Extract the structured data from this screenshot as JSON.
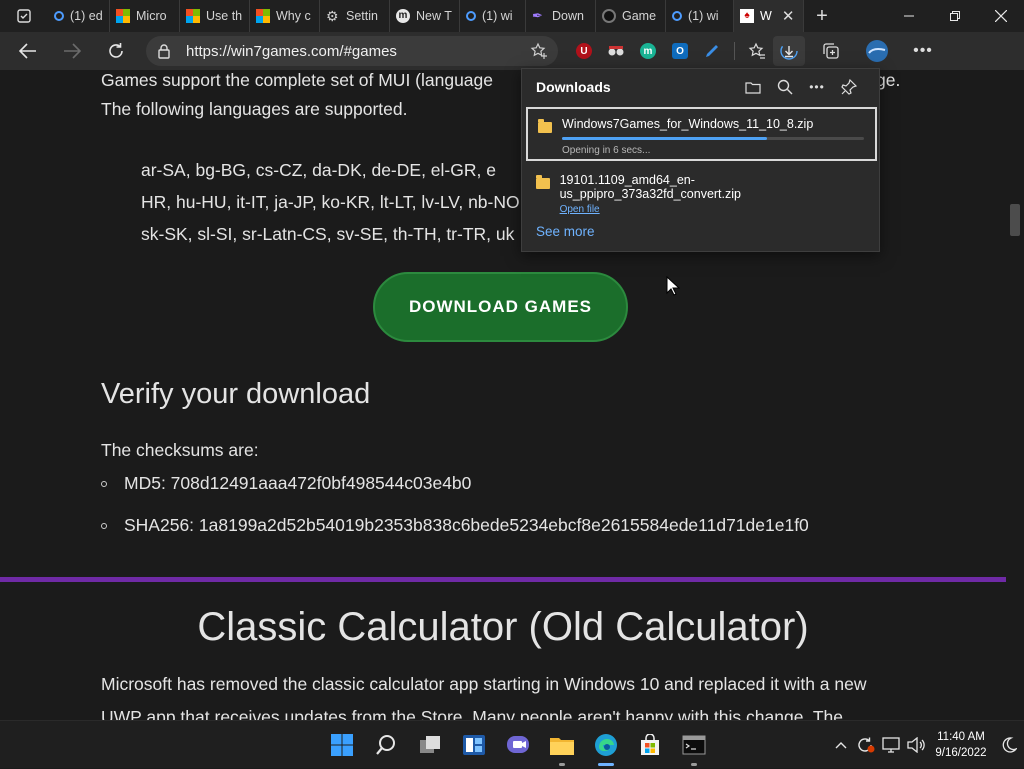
{
  "tabs": [
    {
      "icon": "search-favicon",
      "label": "(1) ed"
    },
    {
      "icon": "microsoft-favicon",
      "label": "Micro"
    },
    {
      "icon": "microsoft-favicon",
      "label": "Use th"
    },
    {
      "icon": "microsoft-favicon",
      "label": "Why c"
    },
    {
      "icon": "gear-favicon",
      "label": "Settin"
    },
    {
      "icon": "m-favicon",
      "label": "New T"
    },
    {
      "icon": "search-favicon",
      "label": "(1) wi"
    },
    {
      "icon": "feather-favicon",
      "label": "Down"
    },
    {
      "icon": "game-favicon",
      "label": "Game"
    },
    {
      "icon": "search-favicon",
      "label": "(1) wi"
    },
    {
      "icon": "win7games-favicon",
      "label": "W",
      "active": true
    }
  ],
  "address_bar": {
    "url": "https://win7games.com/#games"
  },
  "page": {
    "intro_line1": "Games support the complete set of MUI (language",
    "intro_line1_tail": "ge.",
    "intro_line2": "The following languages are supported.",
    "languages_line1": "ar-SA, bg-BG, cs-CZ, da-DK, de-DE, el-GR, e",
    "languages_line2": "HR, hu-HU, it-IT, ja-JP, ko-KR, lt-LT, lv-LV, nb-NO",
    "languages_line3": "sk-SK, sl-SI, sr-Latn-CS, sv-SE, th-TH, tr-TR, uk",
    "download_button": "DOWNLOAD GAMES",
    "verify_heading": "Verify your download",
    "checksums_label": "The checksums are:",
    "md5": "MD5: 708d12491aaa472f0bf498544c03e4b0",
    "sha256": "SHA256: 1a8199a2d52b54019b2353b838c6bede5234ebcf8e2615584ede11d71de1e1f0",
    "calc_heading": "Classic Calculator (Old Calculator)",
    "calc_line1": "Microsoft has removed the classic calculator app starting in Windows 10 and replaced it with a new",
    "calc_line2": "UWP app that receives updates from the Store. Many people aren't happy with this change. The"
  },
  "downloads": {
    "title": "Downloads",
    "items": [
      {
        "name": "Windows7Games_for_Windows_11_10_8.zip",
        "status": "Opening in 6 secs...",
        "progress": 0.68
      },
      {
        "name": "19101.1109_amd64_en-us_ppipro_373a32fd_convert.zip",
        "action": "Open file"
      }
    ],
    "see_more": "See more"
  },
  "taskbar": {
    "time": "11:40 AM",
    "date": "9/16/2022"
  },
  "colors": {
    "accent_purple": "#6f2aa6",
    "download_green": "#1b6e2b",
    "link_blue": "#6fb3ff"
  }
}
